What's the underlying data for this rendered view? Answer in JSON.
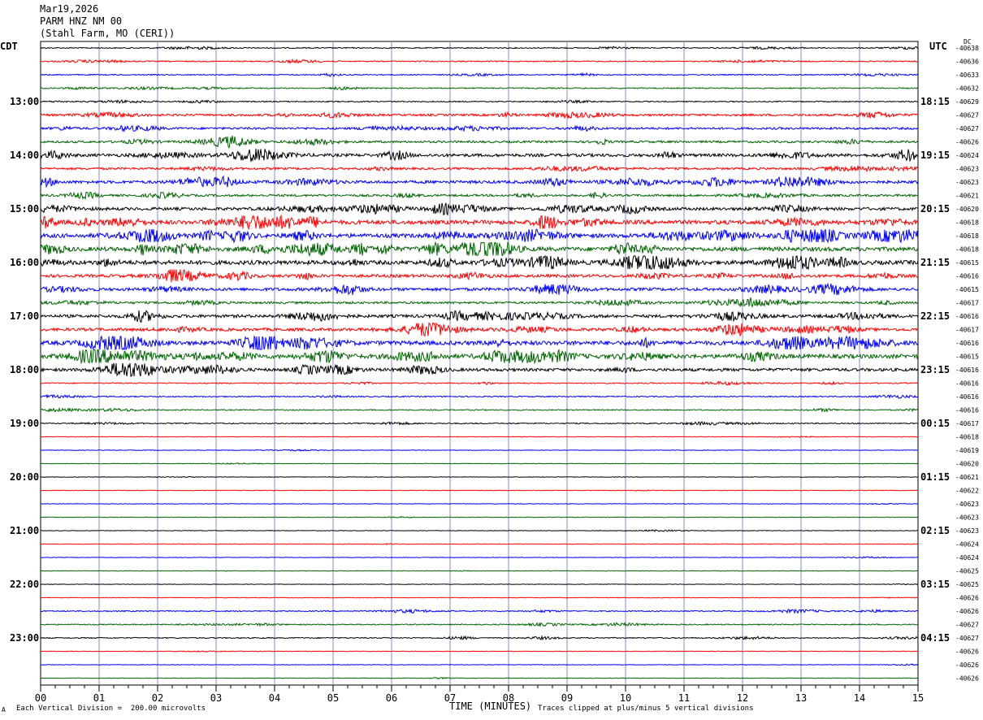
{
  "header": {
    "date": "Mar19,2026",
    "station": "PARM HNZ NM 00",
    "location": "(Stahl Farm, MO (CERI))"
  },
  "tz_left": "CDT",
  "tz_right": "UTC",
  "dc_label": "DC",
  "left_time_labels": [
    "13:00",
    "14:00",
    "15:00",
    "16:00",
    "17:00",
    "18:00",
    "19:00",
    "20:00",
    "21:00",
    "22:00",
    "23:00"
  ],
  "right_time_labels": [
    "18:15",
    "19:15",
    "20:15",
    "21:15",
    "22:15",
    "23:15",
    "00:15",
    "01:15",
    "02:15",
    "03:15",
    "04:15"
  ],
  "dc_values": [
    "-40638",
    "-40636",
    "-40633",
    "-40632",
    "-40629",
    "-40627",
    "-40627",
    "-40626",
    "-40624",
    "-40623",
    "-40623",
    "-40621",
    "-40620",
    "-40618",
    "-40618",
    "-40618",
    "-40615",
    "-40616",
    "-40615",
    "-40617",
    "-40616",
    "-40617",
    "-40616",
    "-40615",
    "-40616",
    "-40616",
    "-40616",
    "-40616",
    "-40617",
    "-40618",
    "-40619",
    "-40620",
    "-40621",
    "-40622",
    "-40623",
    "-40623",
    "-40623",
    "-40624",
    "-40624",
    "-40625",
    "-40625",
    "-40626",
    "-40626",
    "-40627",
    "-40627",
    "-40626",
    "-40626",
    "-40626"
  ],
  "x_ticks": [
    "00",
    "01",
    "02",
    "03",
    "04",
    "05",
    "06",
    "07",
    "08",
    "09",
    "10",
    "11",
    "12",
    "13",
    "14",
    "15"
  ],
  "footer": {
    "mark": "A",
    "scale": "Each Vertical Division =  200.00 microvolts",
    "axis_title": "TIME (MINUTES)",
    "clip_note": "Traces clipped at plus/minus 5 vertical divisions"
  },
  "colors": {
    "trace_cycle": [
      "#000000",
      "#ff0000",
      "#0000ff",
      "#006400"
    ],
    "grid": "#8a8ac8"
  },
  "chart_data": {
    "type": "line",
    "title": "",
    "xlabel": "TIME (MINUTES)",
    "ylabel": "",
    "xlim": [
      0,
      15
    ],
    "trace_count": 48,
    "trace_minutes": 15,
    "trace_amplitude_level": [
      1,
      1,
      1,
      1,
      1,
      2,
      2,
      2,
      3,
      2,
      3,
      2,
      3,
      4,
      4,
      4,
      4,
      3,
      3,
      2,
      3,
      3,
      4,
      4,
      3,
      1,
      1,
      1,
      1,
      0,
      0,
      0,
      0,
      0,
      0,
      0,
      0,
      0,
      0,
      0,
      0,
      0,
      1,
      1,
      1,
      0,
      0,
      0
    ],
    "grid": true
  }
}
